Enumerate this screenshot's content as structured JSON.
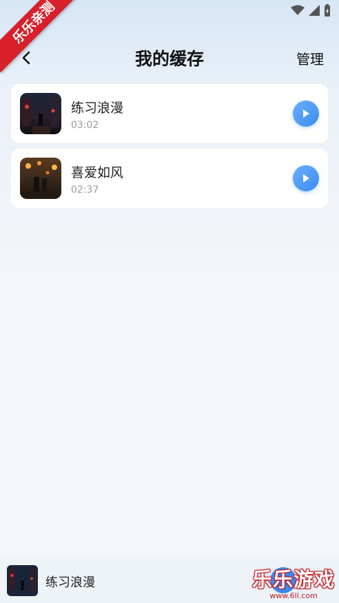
{
  "banner": {
    "text": "乐乐亲测"
  },
  "nav": {
    "title": "我的缓存",
    "manage_label": "管理",
    "back_icon": "chevron-left-icon"
  },
  "songs": [
    {
      "title": "练习浪漫",
      "duration": "03:02"
    },
    {
      "title": "喜爱如风",
      "duration": "02:37"
    }
  ],
  "player": {
    "title": "练习浪漫"
  },
  "watermark": {
    "main": "乐乐游戏",
    "sub": "www.6ll.com"
  },
  "colors": {
    "accent": "#3a8af0",
    "banner_red": "#d8202a",
    "background": "#f5f6f8"
  }
}
